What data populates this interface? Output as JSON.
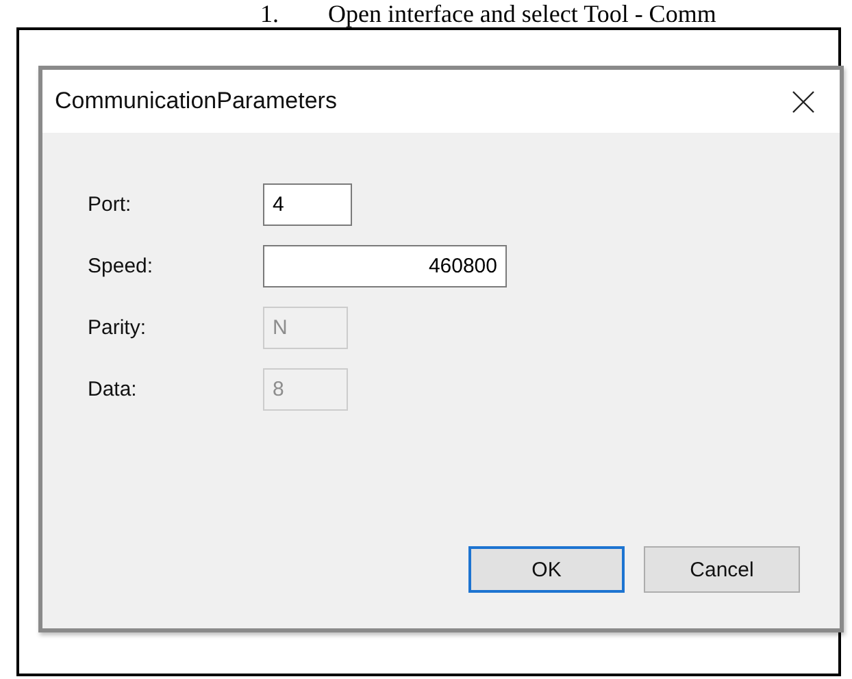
{
  "doc_heading": {
    "number": "1.",
    "text": "Open interface and select Tool - Comm"
  },
  "window": {
    "title": "CommunicationParameters"
  },
  "fields": [
    {
      "kind": "text",
      "label": "Port:",
      "value": "4",
      "disabled": false
    },
    {
      "kind": "number",
      "label": "Speed:",
      "value": "460800",
      "disabled": false
    },
    {
      "kind": "text",
      "label": "Parity:",
      "value": "N",
      "disabled": true
    },
    {
      "kind": "text",
      "label": "Data:",
      "value": "8",
      "disabled": true
    }
  ],
  "buttons": [
    {
      "label": "OK",
      "default": true
    },
    {
      "label": "Cancel",
      "default": false
    }
  ]
}
